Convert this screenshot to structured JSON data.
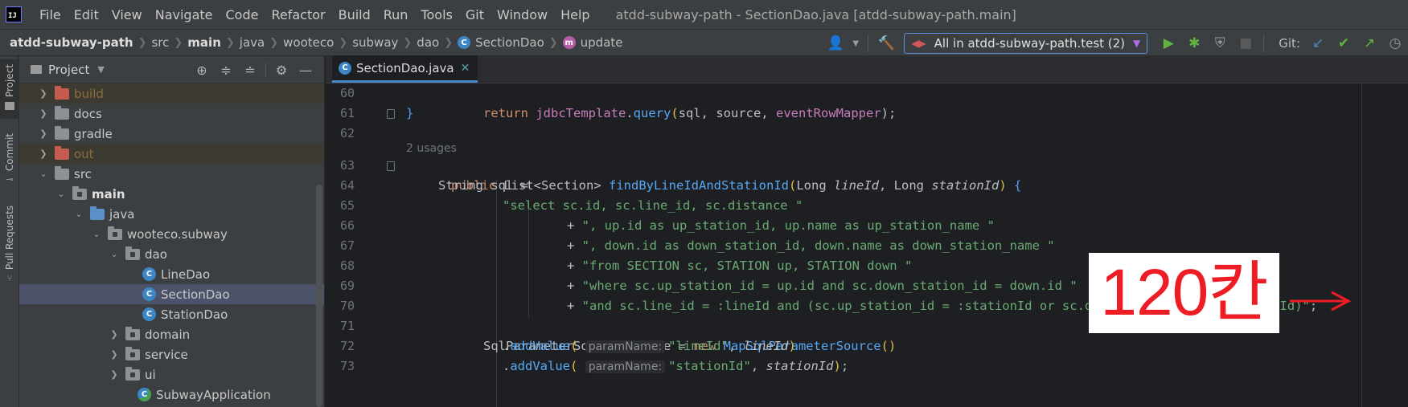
{
  "menubar": {
    "logo": "IJ",
    "items": [
      "File",
      "Edit",
      "View",
      "Navigate",
      "Code",
      "Refactor",
      "Build",
      "Run",
      "Tools",
      "Git",
      "Window",
      "Help"
    ],
    "window_title": "atdd-subway-path - SectionDao.java [atdd-subway-path.main]"
  },
  "breadcrumb": {
    "items": [
      "atdd-subway-path",
      "src",
      "main",
      "java",
      "wooteco",
      "subway",
      "dao",
      "SectionDao",
      "update"
    ]
  },
  "toolbar": {
    "run_config": "All in atdd-subway-path.test (2)",
    "git_label": "Git:"
  },
  "stripe": {
    "project": "Project",
    "commit": "Commit",
    "pull_requests": "Pull Requests"
  },
  "project_panel": {
    "title": "Project",
    "tree": [
      {
        "label": "build"
      },
      {
        "label": "docs"
      },
      {
        "label": "gradle"
      },
      {
        "label": "out"
      },
      {
        "label": "src"
      },
      {
        "label": "main"
      },
      {
        "label": "java"
      },
      {
        "label": "wooteco.subway"
      },
      {
        "label": "dao"
      },
      {
        "label": "LineDao"
      },
      {
        "label": "SectionDao"
      },
      {
        "label": "StationDao"
      },
      {
        "label": "domain"
      },
      {
        "label": "service"
      },
      {
        "label": "ui"
      },
      {
        "label": "SubwayApplication"
      }
    ]
  },
  "editor": {
    "tab_label": "SectionDao.java",
    "usages_hint": "2 usages",
    "line_numbers": [
      "60",
      "61",
      "62",
      "63",
      "64",
      "65",
      "66",
      "67",
      "68",
      "69",
      "70",
      "71",
      "72",
      "73"
    ],
    "code": {
      "l60": {
        "kw": "return",
        "obj": "jdbcTemplate",
        "call": "query",
        "args": "sql, source, ",
        "obj2": "eventRowMapper",
        "tail": ");"
      },
      "l61": "}",
      "l63": {
        "kw": "public",
        "type": "List<Section>",
        "fn": "findByLineIdAndStationId",
        "ptype1": "Long",
        "pname1": "lineId",
        "ptype2": "Long",
        "pname2": "stationId",
        "tail": "{"
      },
      "l64": "String sql =",
      "l65": "\"select sc.id, sc.line_id, sc.distance \"",
      "l66": "\", up.id as up_station_id, up.name as up_station_name \"",
      "l67": "\", down.id as down_station_id, down.name as down_station_name \"",
      "l68": "\"from SECTION sc, STATION up, STATION down \"",
      "l69": "\"where sc.up_station_id = up.id and sc.down_station_id = down.id \"",
      "l70": "\"and sc.line_id = :lineId and (sc.up_station_id = :stationId or sc.down_station_id = :stationId)\"",
      "l71": {
        "type": "SqlParameterSource source = ",
        "kw": "new",
        "fn": "MapSqlParameterSource",
        "tail": "()"
      },
      "l72": {
        "call": "addValue",
        "hint": "paramName:",
        "str": "\"lineId\"",
        "param": "lineId"
      },
      "l73": {
        "call": "addValue",
        "hint": "paramName:",
        "str": "\"stationId\"",
        "param": "stationId"
      }
    }
  },
  "annotation": {
    "text": "120칸",
    "arrow": "→"
  },
  "colors": {
    "accent": "#4a88c7",
    "annotation_red": "#ee1c24",
    "selected_row": "#4b526a",
    "excluded_folder": "#c45c50"
  }
}
